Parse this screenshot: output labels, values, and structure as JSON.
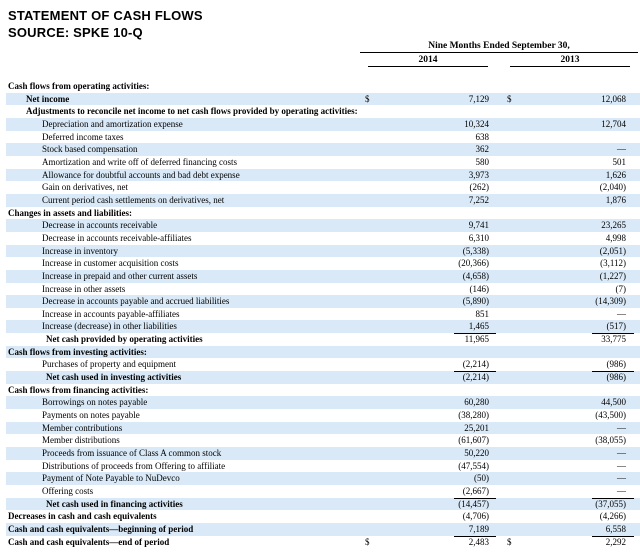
{
  "header": {
    "title": "STATEMENT OF CASH FLOWS",
    "source": "SOURCE: SPKE 10-Q"
  },
  "columns": {
    "group": "Nine Months Ended September 30,",
    "years": [
      "2014",
      "2013"
    ]
  },
  "rows": [
    {
      "label": "Cash flows from operating activities:",
      "indent": 0,
      "bold": true,
      "v1": "",
      "v2": "",
      "shade": false
    },
    {
      "label": "Net income",
      "indent": 1,
      "bold": true,
      "sym1": "$",
      "v1": "7,129",
      "sym2": "$",
      "v2": "12,068",
      "shade": true
    },
    {
      "label": "Adjustments to reconcile net income to net cash flows provided by operating activities:",
      "indent": 1,
      "bold": true,
      "v1": "",
      "v2": "",
      "shade": false
    },
    {
      "label": "Depreciation and amortization expense",
      "indent": 2,
      "v1": "10,324",
      "v2": "12,704",
      "shade": true
    },
    {
      "label": "Deferred income taxes",
      "indent": 2,
      "v1": "638",
      "v2": "",
      "shade": false
    },
    {
      "label": "Stock based compensation",
      "indent": 2,
      "v1": "362",
      "v2": "—",
      "shade": true
    },
    {
      "label": "Amortization and write off of deferred financing costs",
      "indent": 2,
      "v1": "580",
      "v2": "501",
      "shade": false
    },
    {
      "label": "Allowance for doubtful accounts and bad debt expense",
      "indent": 2,
      "v1": "3,973",
      "v2": "1,626",
      "shade": true
    },
    {
      "label": "Gain on derivatives, net",
      "indent": 2,
      "v1": "(262)",
      "v2": "(2,040)",
      "shade": false
    },
    {
      "label": "Current period cash settlements on derivatives, net",
      "indent": 2,
      "v1": "7,252",
      "v2": "1,876",
      "shade": true
    },
    {
      "label": "Changes in assets and liabilities:",
      "indent": 0,
      "bold": true,
      "v1": "",
      "v2": "",
      "shade": false
    },
    {
      "label": "Decrease in accounts receivable",
      "indent": 2,
      "v1": "9,741",
      "v2": "23,265",
      "shade": true
    },
    {
      "label": "Decrease in accounts receivable-affiliates",
      "indent": 2,
      "v1": "6,310",
      "v2": "4,998",
      "shade": false
    },
    {
      "label": "Increase in inventory",
      "indent": 2,
      "v1": "(5,338)",
      "v2": "(2,051)",
      "shade": true
    },
    {
      "label": "Increase in customer acquisition costs",
      "indent": 2,
      "v1": "(20,366)",
      "v2": "(3,112)",
      "shade": false
    },
    {
      "label": "Increase in prepaid and other current assets",
      "indent": 2,
      "v1": "(4,658)",
      "v2": "(1,227)",
      "shade": true
    },
    {
      "label": "Increase in other assets",
      "indent": 2,
      "v1": "(146)",
      "v2": "(7)",
      "shade": false
    },
    {
      "label": "Decrease in accounts payable and accrued liabilities",
      "indent": 2,
      "v1": "(5,890)",
      "v2": "(14,309)",
      "shade": true
    },
    {
      "label": "Increase in accounts payable-affiliates",
      "indent": 2,
      "v1": "851",
      "v2": "—",
      "shade": false
    },
    {
      "label": "Increase (decrease) in other liabilities",
      "indent": 2,
      "v1": "1,465",
      "v2": "(517)",
      "shade": true
    },
    {
      "label": "Net cash provided by operating activities",
      "indent": 3,
      "bold": true,
      "v1": "11,965",
      "v2": "33,775",
      "shade": false,
      "topline": true
    },
    {
      "label": "Cash flows from investing activities:",
      "indent": 0,
      "bold": true,
      "v1": "",
      "v2": "",
      "shade": true
    },
    {
      "label": "Purchases of property and equipment",
      "indent": 2,
      "v1": "(2,214)",
      "v2": "(986)",
      "shade": false
    },
    {
      "label": "Net cash used in investing activities",
      "indent": 3,
      "bold": true,
      "v1": "(2,214)",
      "v2": "(986)",
      "shade": true,
      "topline": true
    },
    {
      "label": "Cash flows from financing activities:",
      "indent": 0,
      "bold": true,
      "v1": "",
      "v2": "",
      "shade": false
    },
    {
      "label": "Borrowings on notes payable",
      "indent": 2,
      "v1": "60,280",
      "v2": "44,500",
      "shade": true
    },
    {
      "label": "Payments on notes payable",
      "indent": 2,
      "v1": "(38,280)",
      "v2": "(43,500)",
      "shade": false
    },
    {
      "label": "Member contributions",
      "indent": 2,
      "v1": "25,201",
      "v2": "—",
      "shade": true
    },
    {
      "label": "Member distributions",
      "indent": 2,
      "v1": "(61,607)",
      "v2": "(38,055)",
      "shade": false
    },
    {
      "label": "Proceeds from issuance of Class A common stock",
      "indent": 2,
      "v1": "50,220",
      "v2": "—",
      "shade": true
    },
    {
      "label": "Distributions of proceeds from Offering to affiliate",
      "indent": 2,
      "v1": "(47,554)",
      "v2": "—",
      "shade": false
    },
    {
      "label": "Payment of Note Payable to NuDevco",
      "indent": 2,
      "v1": "(50)",
      "v2": "—",
      "shade": true
    },
    {
      "label": "Offering costs",
      "indent": 2,
      "v1": "(2,667)",
      "v2": "—",
      "shade": false
    },
    {
      "label": "Net cash used in financing activities",
      "indent": 3,
      "bold": true,
      "v1": "(14,457)",
      "v2": "(37,055)",
      "shade": true,
      "topline": true
    },
    {
      "label": "Decreases in cash and cash equivalents",
      "indent": 0,
      "bold": true,
      "v1": "(4,706)",
      "v2": "(4,266)",
      "shade": false
    },
    {
      "label": "Cash and cash equivalents—beginning of period",
      "indent": 0,
      "bold": true,
      "v1": "7,189",
      "v2": "6,558",
      "shade": true
    },
    {
      "label": "Cash and cash equivalents—end of period",
      "indent": 0,
      "bold": true,
      "sym1": "$",
      "v1": "2,483",
      "sym2": "$",
      "v2": "2,292",
      "shade": false,
      "topline": true
    }
  ]
}
